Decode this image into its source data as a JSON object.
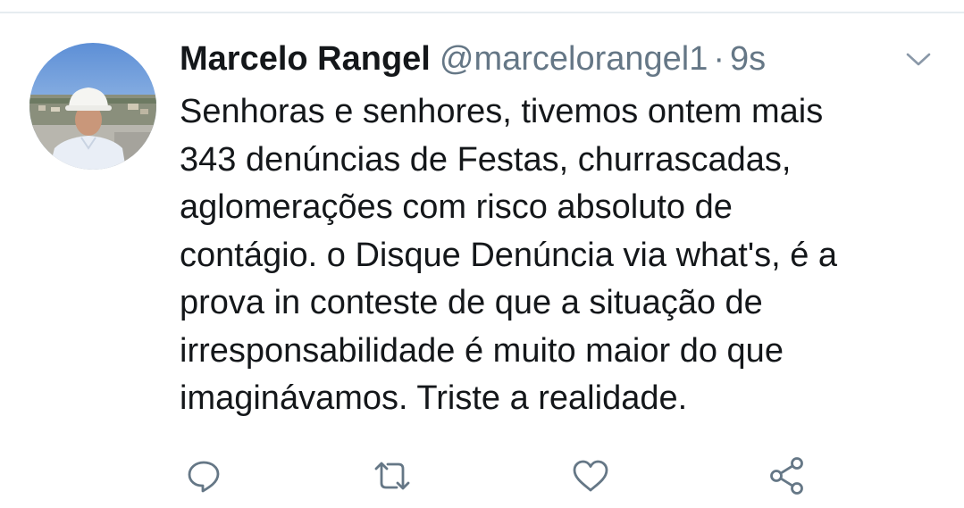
{
  "tweet": {
    "display_name": "Marcelo Rangel",
    "handle": "@marcelorangel1",
    "separator": "·",
    "time": "9s",
    "text_lines": [
      "Senhoras e senhores, tivemos ontem mais",
      "343 denúncias de Festas, churrascadas,",
      "aglomerações com risco absoluto de",
      "contágio. o Disque Denúncia via what's, é a",
      "prova in conteste de que a situação de",
      "irresponsabilidade é muito maior do que",
      "imaginávamos. Triste a realidade."
    ]
  },
  "icons": {
    "menu": "chevron-down-icon",
    "reply": "reply-icon",
    "retweet": "retweet-icon",
    "like": "heart-icon",
    "share": "share-icon"
  },
  "colors": {
    "text_primary": "#14171a",
    "text_secondary": "#657786",
    "icon": "#657786",
    "divider": "#e6ecf0"
  }
}
